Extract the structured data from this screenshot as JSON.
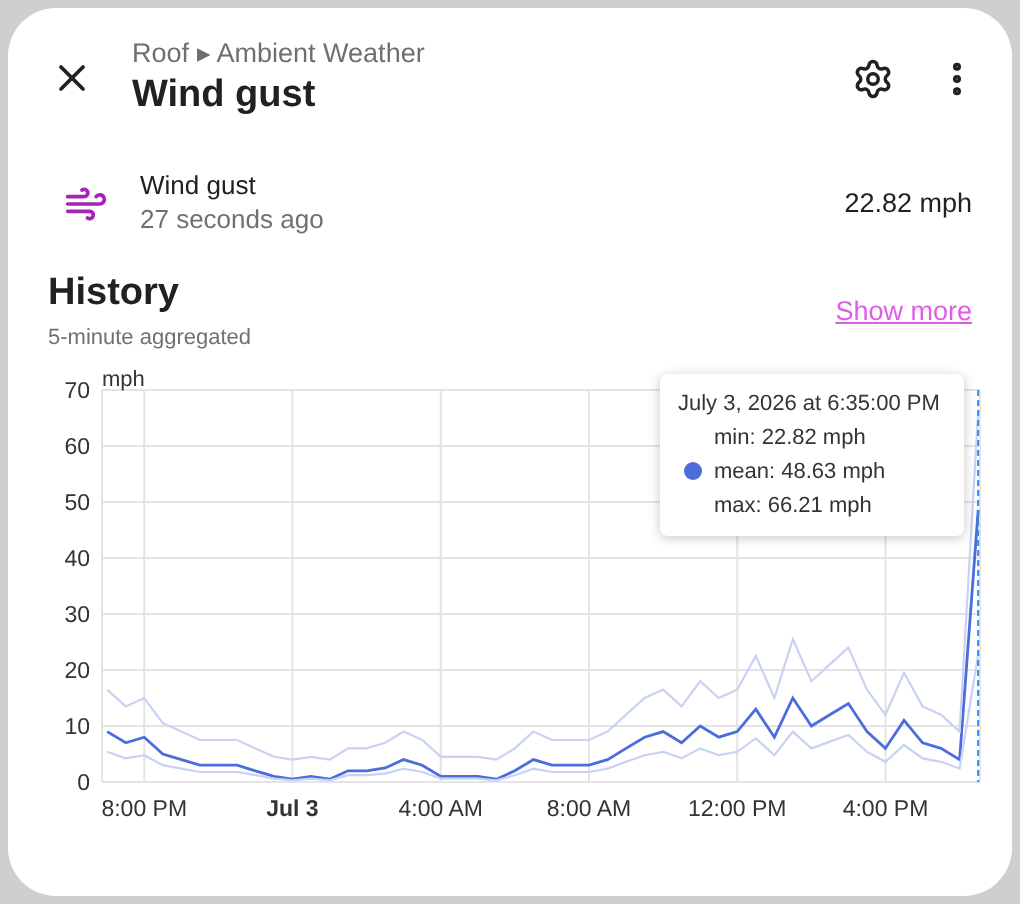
{
  "header": {
    "breadcrumb": [
      "Roof",
      "Ambient Weather"
    ],
    "separator": "▸",
    "title": "Wind gust"
  },
  "entity": {
    "name": "Wind gust",
    "last_changed": "27 seconds ago",
    "state": "22.82 mph"
  },
  "history": {
    "title": "History",
    "subtitle": "5-minute aggregated",
    "show_more": "Show more",
    "chart_data": {
      "type": "line",
      "ylabel": "mph",
      "grid": true,
      "ylim": [
        0,
        70
      ],
      "yticks": [
        0,
        10,
        20,
        30,
        40,
        50,
        60,
        70
      ],
      "categories": [
        null,
        null,
        "8:00 PM",
        null,
        null,
        null,
        null,
        null,
        null,
        null,
        "Jul 3",
        null,
        null,
        null,
        null,
        null,
        null,
        null,
        "4:00 AM",
        null,
        null,
        null,
        null,
        null,
        null,
        null,
        "8:00 AM",
        null,
        null,
        null,
        null,
        null,
        null,
        null,
        "12:00 PM",
        null,
        null,
        null,
        null,
        null,
        null,
        null,
        "4:00 PM",
        null,
        null,
        null,
        null,
        null
      ],
      "series": [
        {
          "color": "#c8d2f3",
          "values": [
            5.4,
            4.2,
            4.8,
            3,
            2.4,
            1.8,
            1.8,
            1.8,
            1.2,
            0.6,
            0.3,
            0.6,
            0.3,
            1.2,
            1.2,
            1.5,
            2.4,
            1.8,
            0.6,
            0.6,
            0.6,
            0.3,
            1.2,
            2.4,
            1.8,
            1.8,
            1.8,
            2.4,
            3.6,
            4.8,
            5.4,
            4.2,
            6,
            4.8,
            5.4,
            7.8,
            4.8,
            9,
            6,
            7.2,
            8.4,
            5.4,
            3.6,
            6.6,
            4.2,
            3.6,
            2.4,
            22.8
          ]
        },
        {
          "color": "#4a6ddb",
          "values": [
            9,
            7,
            8,
            5,
            4,
            3,
            3,
            3,
            2,
            1,
            0.5,
            1,
            0.5,
            2,
            2,
            2.5,
            4,
            3,
            1,
            1,
            1,
            0.5,
            2,
            4,
            3,
            3,
            3,
            4,
            6,
            8,
            9,
            7,
            10,
            8,
            9,
            13,
            8,
            15,
            10,
            12,
            14,
            9,
            6,
            11,
            7,
            6,
            4,
            48.6
          ]
        },
        {
          "color": "#c8d2f3",
          "values": [
            16.5,
            13.5,
            15,
            10.5,
            9,
            7.5,
            7.5,
            7.5,
            6,
            4.5,
            4,
            4.5,
            4,
            6,
            6,
            7,
            9,
            7.5,
            4.5,
            4.5,
            4.5,
            4,
            6,
            9,
            7.5,
            7.5,
            7.5,
            9,
            12,
            15,
            16.5,
            13.5,
            18,
            15,
            16.5,
            22.5,
            15,
            25.5,
            18,
            21,
            24,
            16.5,
            12,
            19.5,
            13.5,
            12,
            9,
            66.2
          ]
        }
      ]
    },
    "tooltip": {
      "title": "July 3, 2026 at 6:35:00 PM",
      "lines": [
        {
          "text": "min: 22.82 mph",
          "marker": false
        },
        {
          "text": "mean: 48.63 mph",
          "marker": true
        },
        {
          "text": "max: 66.21 mph",
          "marker": false
        }
      ]
    }
  }
}
